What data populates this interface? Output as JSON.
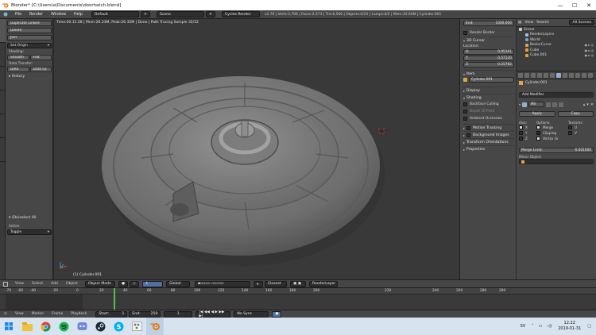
{
  "window": {
    "title": "Blender* [C:\\Users\\a\\Documents\\doorhatch.blend]",
    "minimize": "—",
    "maximize": "☐",
    "close": "✕"
  },
  "info_header": {
    "menus": [
      "File",
      "Render",
      "Window",
      "Help"
    ],
    "layout": "Default",
    "scene": "Scene",
    "engine": "Cycles Render",
    "stats": "v2.79 | Verts:2,706 | Faces:2,573 | Tris:6,560 | Objects:0/25 | Lamps:0/2 | Mem:32.64M | Cylinder.001"
  },
  "tool_shelf": {
    "buttons": [
      "Duplicate Linked",
      "Delete",
      "Join"
    ],
    "set_origin": "Set Origin",
    "shading_label": "Shading:",
    "shading_smooth": "Smooth",
    "shading_flat": "Flat",
    "data_transfer_label": "Data Transfer:",
    "data_btn": "Data",
    "data_layout_btn": "Data La",
    "history": "History",
    "operator_title": "(De)select All",
    "action_label": "Action",
    "action_value": "Toggle"
  },
  "viewport": {
    "render_info": "Time:00:15.08 | Mem:26.33M, Peak:26.35M | Done | Path Tracing Sample 32/32",
    "object_label": "(1) Cylinder.001"
  },
  "n_panel": {
    "end_label": "End:",
    "end_value": "1000.000",
    "render_border": "Render Border",
    "cursor_title": "3D Cursor",
    "location_label": "Location:",
    "x_label": "X:",
    "x_value": "0.95161",
    "y_label": "Y:",
    "y_value": "0.57120",
    "z_label": "Z:",
    "z_value": "0.25782",
    "item_title": "Item",
    "item_name": "Cylinder.001",
    "display": "Display",
    "shading": "Shading",
    "backface": "Backface Culling",
    "depth_of_field": "Depth Of Field",
    "ambient_occlusion": "Ambient Occlusion",
    "motion_tracking": "Motion Tracking",
    "background_images": "Background Images",
    "transform_orientations": "Transform Orientations",
    "properties": "Properties"
  },
  "outliner": {
    "view": "View",
    "search": "Search",
    "all_scenes": "All Scenes",
    "items": [
      "Scene",
      "RenderLayers",
      "World",
      "BezierCurve",
      "Cube",
      "Cube.001"
    ]
  },
  "properties": {
    "object_name": "Cylinder.001",
    "add_modifier": "Add Modifier",
    "modifier_name": "Mir",
    "apply": "Apply",
    "copy": "Copy",
    "axis_label": "Axis:",
    "options_label": "Options:",
    "textures_label": "Textures:",
    "axes": [
      "X",
      "Y",
      "Z"
    ],
    "merge": "Merge",
    "clipping": "Clipping",
    "vertex_gr": "Vertex Gr",
    "tex_u": "U",
    "tex_v": "V",
    "merge_limit_label": "Merge Limit:",
    "merge_limit_value": "0.001000",
    "mirror_object": "Mirror Object:"
  },
  "view_header": {
    "menus": [
      "View",
      "Select",
      "Add",
      "Object"
    ],
    "mode": "Object Mode",
    "pivot": "Global",
    "snap": "Closest",
    "render_layer": "RenderLayer"
  },
  "timeline": {
    "ticks": [
      "-70",
      "-60",
      "-40",
      "-20",
      "0",
      "20",
      "40",
      "60",
      "80",
      "100",
      "120",
      "140",
      "160",
      "180",
      "200",
      "220",
      "240",
      "260",
      "280",
      "290"
    ],
    "menus": [
      "View",
      "Marker",
      "Frame",
      "Playback"
    ],
    "start_label": "Start:",
    "start_value": "1",
    "end_label": "End:",
    "end_value": "250",
    "current": "1",
    "sync": "No Sync"
  },
  "taskbar": {
    "apps": [
      "start",
      "explorer",
      "chrome",
      "spotify",
      "discord",
      "steam",
      "skype",
      "paint",
      "blender"
    ],
    "lang": "SV",
    "time": "12:22",
    "date": "2019-01-31"
  }
}
